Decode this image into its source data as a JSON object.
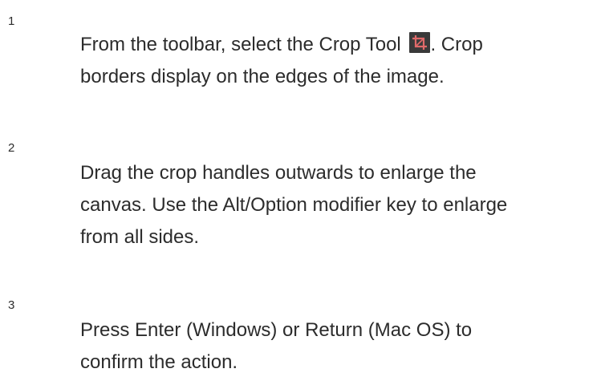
{
  "steps": [
    {
      "number": "1",
      "lines": [
        "From the toolbar, select the Crop Tool",
        ". Crop",
        "borders display on the edges of the image."
      ],
      "icon": "crop-tool-icon"
    },
    {
      "number": "2",
      "lines": [
        "Drag the crop handles outwards to enlarge the",
        "canvas. Use the Alt/Option modifier key to enlarge",
        "from all sides."
      ]
    },
    {
      "number": "3",
      "lines": [
        "Press Enter (Windows) or Return (Mac OS) to",
        "confirm the action."
      ]
    }
  ],
  "colors": {
    "text": "#2c2c2c",
    "icon_bg": "#3a3a3a",
    "icon_fg": "#e06a6a"
  }
}
